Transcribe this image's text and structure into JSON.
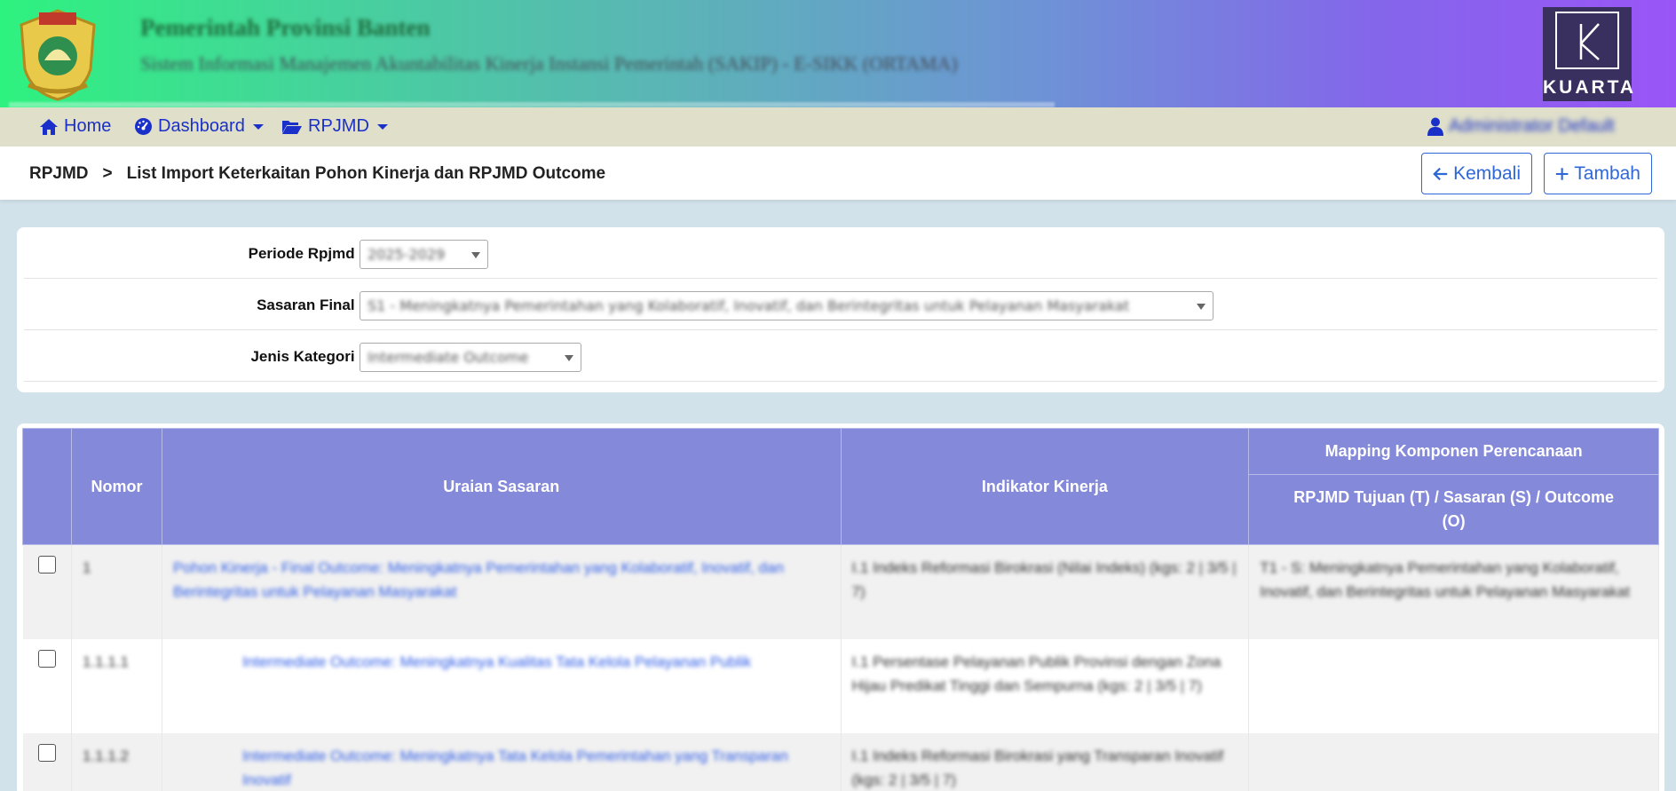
{
  "header": {
    "title": "Pemerintah Provinsi Banten",
    "subtitle": "Sistem Informasi Manajemen Akuntabilitas Kinerja Instansi Pemerintah (SAKIP) - E-SIKK (ORTAMA)",
    "brand": "KUARTA"
  },
  "nav": {
    "home": "Home",
    "dashboard": "Dashboard",
    "rpjmd": "RPJMD",
    "user": "Administrator Default"
  },
  "breadcrumb": {
    "root": "RPJMD",
    "separator": ">",
    "current": "List Import Keterkaitan Pohon Kinerja dan RPJMD Outcome"
  },
  "buttons": {
    "back": "Kembali",
    "add": "Tambah"
  },
  "filters": {
    "periode_label": "Periode Rpjmd :",
    "periode_value": "2025-2029",
    "sasaran_label": "Sasaran Final :",
    "sasaran_value": "S1 - Meningkatnya Pemerintahan yang Kolaboratif, Inovatif, dan Berintegritas untuk Pelayanan Masyarakat",
    "kategori_label": "Jenis Kategori :",
    "kategori_value": "Intermediate Outcome"
  },
  "table": {
    "headers": {
      "nomor": "Nomor",
      "uraian": "Uraian Sasaran",
      "indikator": "Indikator Kinerja",
      "mapping_group": "Mapping Komponen Perencanaan",
      "mapping": "RPJMD Tujuan (T) / Sasaran (S) / Outcome (O)"
    },
    "rows": [
      {
        "nomor": "1",
        "uraian": "Pohon Kinerja - Final Outcome: Meningkatnya Pemerintahan yang Kolaboratif, Inovatif, dan Berintegritas untuk Pelayanan Masyarakat",
        "indikator": "I.1 Indeks Reformasi Birokrasi (Nilai Indeks) (kgs: 2 | 3/5 | 7)",
        "mapping": "T1 - S: Meningkatnya Pemerintahan yang Kolaboratif, Inovatif, dan Berintegritas untuk Pelayanan Masyarakat"
      },
      {
        "nomor": "1.1.1.1",
        "uraian": "Intermediate Outcome: Meningkatnya Kualitas Tata Kelola Pelayanan Publik",
        "indikator": "I.1 Persentase Pelayanan Publik Provinsi dengan Zona Hijau Predikat Tinggi dan Sempurna (kgs: 2 | 3/5 | 7)",
        "mapping": ""
      },
      {
        "nomor": "1.1.1.2",
        "uraian": "Intermediate Outcome: Meningkatnya Tata Kelola Pemerintahan yang Transparan Inovatif",
        "indikator": "I.1 Indeks Reformasi Birokrasi yang Transparan Inovatif (kgs: 2 | 3/5 | 7)",
        "mapping": ""
      }
    ]
  }
}
